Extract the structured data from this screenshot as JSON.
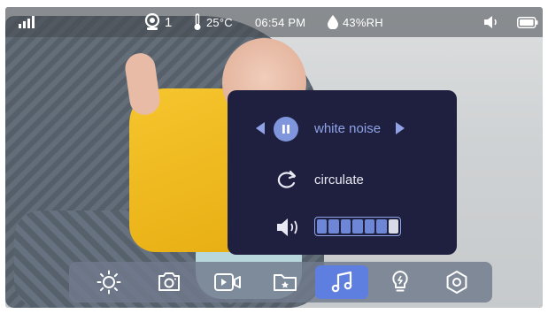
{
  "status": {
    "camera_count": "1",
    "temperature": "25°C",
    "time": "06:54 PM",
    "humidity": "43%RH",
    "signal_icon": "signal-bars-icon",
    "camera_icon": "camera-icon",
    "temperature_icon": "thermometer-icon",
    "humidity_icon": "water-drop-icon",
    "speaker_icon": "speaker-icon",
    "battery_icon": "battery-icon"
  },
  "music_panel": {
    "track_name": "white noise",
    "mode_label": "circulate",
    "volume_level": 6,
    "volume_max": 7,
    "icons": [
      "prev-arrow-icon",
      "pause-icon",
      "next-arrow-icon",
      "circulate-icon",
      "volume-icon"
    ]
  },
  "toolbar": {
    "items": [
      {
        "name": "brightness",
        "icon": "sun-icon",
        "active": false
      },
      {
        "name": "snapshot",
        "icon": "camera-icon",
        "active": false
      },
      {
        "name": "record",
        "icon": "video-icon",
        "active": false
      },
      {
        "name": "files",
        "icon": "folder-icon",
        "active": false
      },
      {
        "name": "music",
        "icon": "music-note-icon",
        "active": true
      },
      {
        "name": "night-light",
        "icon": "bulb-icon",
        "active": false
      },
      {
        "name": "settings",
        "icon": "settings-icon",
        "active": false
      }
    ]
  },
  "colors": {
    "panel_bg": "#1f2040",
    "accent": "#7f96dc",
    "active_tool": "#5f7fe0",
    "toolbar_bg": "#707a8c"
  }
}
